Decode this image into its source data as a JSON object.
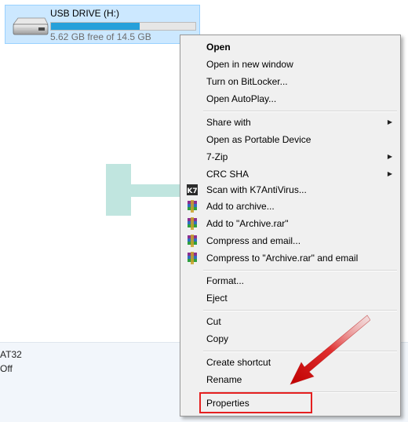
{
  "drive": {
    "name": "USB DRIVE (H:)",
    "free_text": "5.62 GB free of 14.5 GB",
    "used_fraction": 0.612
  },
  "details": {
    "line1": "AT32",
    "line2": "Off"
  },
  "colors": {
    "selection_bg": "#cce8ff",
    "progress_fill": "#26a0da",
    "highlight": "#e52020"
  },
  "menu": {
    "open": "Open",
    "open_new_window": "Open in new window",
    "bitlocker": "Turn on BitLocker...",
    "autoplay": "Open AutoPlay...",
    "share_with": "Share with",
    "portable_device": "Open as Portable Device",
    "zip7": "7-Zip",
    "crc_sha": "CRC SHA",
    "k7_scan": "Scan with K7AntiVirus...",
    "add_archive": "Add to archive...",
    "add_archive_rar": "Add to \"Archive.rar\"",
    "compress_email": "Compress and email...",
    "compress_rar_email": "Compress to \"Archive.rar\" and email",
    "format": "Format...",
    "eject": "Eject",
    "cut": "Cut",
    "copy": "Copy",
    "create_shortcut": "Create shortcut",
    "rename": "Rename",
    "properties": "Properties",
    "submenu_arrow": "▶"
  },
  "icons": {
    "drive": "usb-drive-icon",
    "k7": "k7-antivirus-icon",
    "winrar": "winrar-icon"
  }
}
